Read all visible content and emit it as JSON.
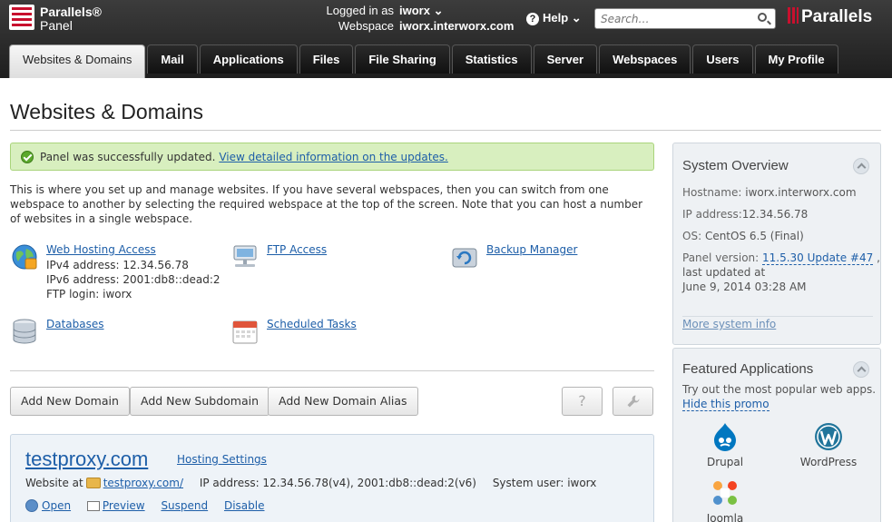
{
  "brand": {
    "panel_line1": "Parallels®",
    "panel_line2": "Panel",
    "logo_text": "Parallels"
  },
  "user": {
    "logged_label": "Logged in as",
    "logged_value": "iworx ⌄",
    "webspace_label": "Webspace",
    "webspace_value": "iworx.interworx.com"
  },
  "help": {
    "label": "Help ⌄",
    "icon": "question-icon"
  },
  "search": {
    "placeholder": "Search…",
    "icon": "magnifier-icon"
  },
  "tabs": [
    {
      "label": "Websites & Domains",
      "active": true
    },
    {
      "label": "Mail"
    },
    {
      "label": "Applications"
    },
    {
      "label": "Files"
    },
    {
      "label": "File Sharing"
    },
    {
      "label": "Statistics"
    },
    {
      "label": "Server"
    },
    {
      "label": "Webspaces"
    },
    {
      "label": "Users"
    },
    {
      "label": "My Profile"
    }
  ],
  "page": {
    "title": "Websites & Domains"
  },
  "notice": {
    "text": "Panel was successfully updated.",
    "link": "View detailed information on the updates."
  },
  "intro": "This is where you set up and manage websites. If you have several webspaces, then you can switch from one webspace to another by selecting the required webspace at the top of the screen. Note that you can host a number of websites in a single webspace.",
  "tools": {
    "web_hosting": {
      "name": "Web Hosting Access",
      "ipv4": "IPv4 address: 12.34.56.78",
      "ipv6": "IPv6 address: 2001:db8::dead:2",
      "ftp_login": "FTP login: iworx",
      "icon": "globe-icon"
    },
    "ftp": {
      "name": "FTP Access",
      "icon": "ftp-icon"
    },
    "backup": {
      "name": "Backup Manager",
      "icon": "backup-icon"
    },
    "databases": {
      "name": "Databases",
      "icon": "database-icon"
    },
    "scheduled": {
      "name": "Scheduled Tasks",
      "icon": "calendar-icon"
    }
  },
  "buttons": {
    "add_domain": "Add New Domain",
    "add_subdomain": "Add New Subdomain",
    "add_alias": "Add New Domain Alias",
    "help_icon": "?",
    "settings_icon": "wrench-icon"
  },
  "domain": {
    "name": "testproxy.com",
    "hosting_settings": "Hosting Settings",
    "website_at_label": "Website at",
    "website_at_link": "testproxy.com/",
    "ip": "IP address: 12.34.56.78(v4), 2001:db8::dead:2(v6)",
    "system_user": "System user: iworx",
    "actions": {
      "open": "Open",
      "preview": "Preview",
      "suspend": "Suspend",
      "disable": "Disable"
    }
  },
  "system_overview": {
    "title": "System Overview",
    "hostname_label": "Hostname:",
    "hostname": "iworx.interworx.com",
    "ip_label": "IP address:",
    "ip": "12.34.56.78",
    "os_label": "OS:",
    "os": "CentOS 6.5 (Final)",
    "version_label": "Panel version:",
    "version": "11.5.30 Update #47",
    "version_suffix": ",",
    "last_updated_label": "last updated at",
    "last_updated": "June 9, 2014 03:28 AM",
    "more_info": "More system info"
  },
  "featured": {
    "title": "Featured Applications",
    "description": "Try out the most popular web apps.",
    "hide_promo": "Hide this promo",
    "apps": [
      {
        "name": "Drupal",
        "icon": "drupal-icon",
        "color": "#0077c0"
      },
      {
        "name": "WordPress",
        "icon": "wordpress-icon",
        "color": "#21759b"
      },
      {
        "name": "Joomla",
        "icon": "joomla-icon",
        "color": "#f44321"
      }
    ]
  },
  "colors": {
    "link": "#1d5ea8",
    "notice_bg": "#d8efbf",
    "topbar": "#2a2a2a",
    "brand_red": "#c8102e"
  }
}
